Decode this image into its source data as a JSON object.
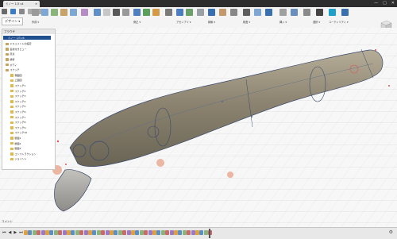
{
  "tab": {
    "title": "ミノー 1/3 v4"
  },
  "window": {
    "minimize": "—",
    "maximize": "□",
    "close": "✕"
  },
  "toolbar": {
    "workspace": "デザイン ▾",
    "groups": [
      "作成 ▾",
      "修正 ▾",
      "アセンブリ ▾",
      "構築 ▾",
      "検査 ▾",
      "挿入 ▾",
      "選択 ▾",
      "ユーティリティ ▾"
    ]
  },
  "browser": {
    "title": "ブラウザ",
    "root": "ミノー 1/3 v4",
    "items": [
      "ドキュメントの設定",
      "名前付きビュー",
      "原点",
      "解析",
      "ボディ",
      "スケッチ",
      "側面図",
      "上面図",
      "スケッチ1",
      "スケッチ2",
      "スケッチ3",
      "スケッチ4",
      "スケッチ5",
      "スケッチ6",
      "スケッチ7",
      "スケッチ8",
      "スケッチ9",
      "スケッチ10",
      "断面1",
      "断面2",
      "断面3",
      "コンストラクション",
      "ジョイント"
    ]
  },
  "comments": {
    "label": "コメント"
  },
  "timeline": {
    "controls": [
      "⏮",
      "◀",
      "▶",
      "⏭"
    ],
    "settings": "⚙",
    "feature_count": 44
  },
  "colors": {
    "accent": "#1f4f8f",
    "body_fill": "#8c8470",
    "body_highlight": "#b5ad98",
    "edge": "#3a4a6a",
    "highlight_red": "#d9534f",
    "face_pink": "#e8a68c"
  }
}
